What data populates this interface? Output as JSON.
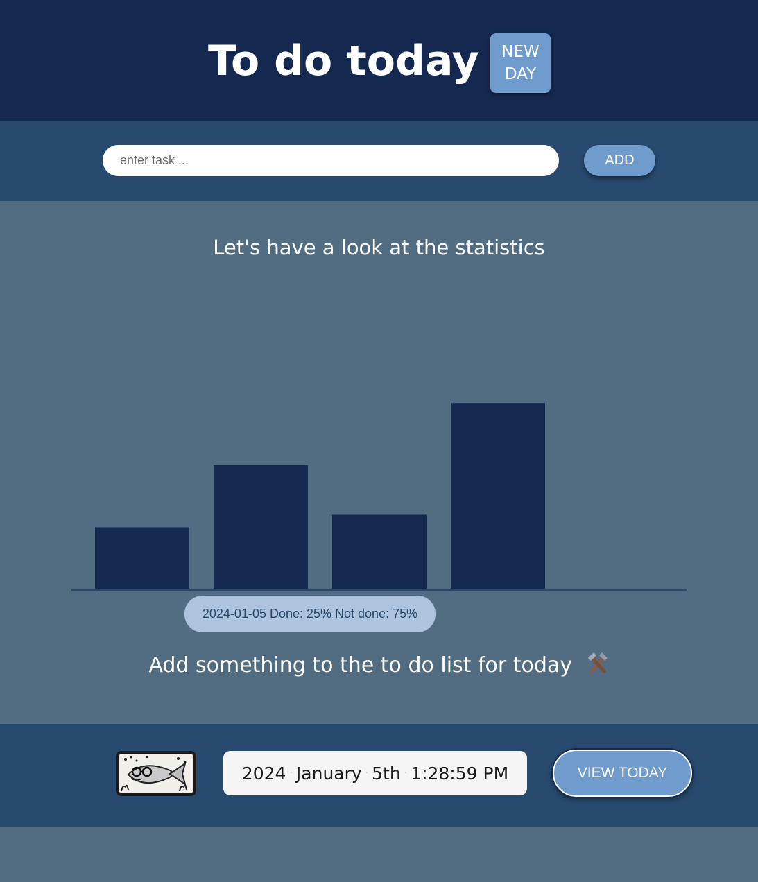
{
  "header": {
    "title": "To do today",
    "new_day_line1": "NEW",
    "new_day_line2": "DAY"
  },
  "input_bar": {
    "placeholder": "enter task ...",
    "value": "",
    "add_label": "ADD"
  },
  "stats": {
    "heading": "Let's have a look at the statistics",
    "tooltip": "2024-01-05 Done: 25% Not done: 75%"
  },
  "chart_data": {
    "type": "bar",
    "categories": [
      "",
      "",
      "",
      ""
    ],
    "values": [
      2.5,
      5,
      3,
      7.5
    ],
    "ylim": [
      0,
      12
    ],
    "title": "",
    "xlabel": "",
    "ylabel": "",
    "grid": false,
    "bar_color": "#152850",
    "axis_color": "#27496d"
  },
  "empty_message": {
    "text": "Add something to the to do list for today",
    "icon": "hammer-and-pick-icon"
  },
  "footer": {
    "logo_icon": "fish-with-glasses-icon",
    "date": {
      "year": "2024",
      "month": "January",
      "day": "5th",
      "time": "1:28:59 PM"
    },
    "view_today_label": "VIEW TODAY"
  },
  "colors": {
    "header_bg": "#152850",
    "bar_bg": "#27496d",
    "main_bg": "#526d82",
    "accent": "#6f9ccd",
    "tooltip_bg": "#aec3dd"
  }
}
